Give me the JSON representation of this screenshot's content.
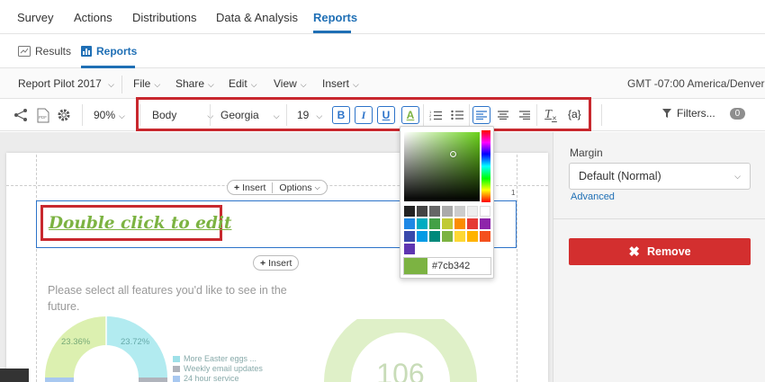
{
  "top_nav": {
    "items": [
      "Survey",
      "Actions",
      "Distributions",
      "Data & Analysis",
      "Reports"
    ],
    "active": "Reports"
  },
  "sub_nav": {
    "results_label": "Results",
    "reports_label": "Reports",
    "active": "Reports"
  },
  "menu_bar": {
    "report_label": "Report",
    "report_name": "Pilot 2017",
    "menus": [
      "File",
      "Share",
      "Edit",
      "View",
      "Insert"
    ],
    "timezone": "GMT -07:00 America/Denver"
  },
  "toolbar": {
    "pdf_label": "PDF",
    "zoom": "90%",
    "style": "Body",
    "font": "Georgia",
    "size": "19",
    "bold": "B",
    "italic": "I",
    "underline": "U",
    "text_color_glyph": "A",
    "clear_format_glyph": "T",
    "piped_text": "{a}",
    "filters_label": "Filters...",
    "filters_count": "0"
  },
  "canvas": {
    "insert_label": "Insert",
    "options_label": "Options",
    "page_number": "1",
    "edit_text": "Double click to edit",
    "question_text": "Please select all features you'd like to see in the future.",
    "donut_labels": [
      "23.36%",
      "23.72%"
    ],
    "legend": [
      {
        "label": "More Easter eggs ...",
        "color": "#9ee0e8"
      },
      {
        "label": "Weekly email updates",
        "color": "#b0b4bc"
      },
      {
        "label": "24 hour service",
        "color": "#a8c8f0"
      }
    ],
    "gauge_value": "106"
  },
  "color_picker": {
    "hex": "#7cb342",
    "swatches": [
      "#222222",
      "#444444",
      "#666666",
      "#aaaaaa",
      "#cccccc",
      "#eeeeee",
      "#ffffff",
      "#1e88e5",
      "#00acc1",
      "#43a047",
      "#c0ca33",
      "#fb8c00",
      "#e53935",
      "#8e24aa",
      "#3949ab",
      "#039be5",
      "#00897b",
      "#7cb342",
      "#fdd835",
      "#ffb300",
      "#f4511e",
      "#5e35b1"
    ]
  },
  "right_panel": {
    "margin_label": "Margin",
    "margin_value": "Default (Normal)",
    "advanced_label": "Advanced",
    "remove_label": "Remove"
  }
}
